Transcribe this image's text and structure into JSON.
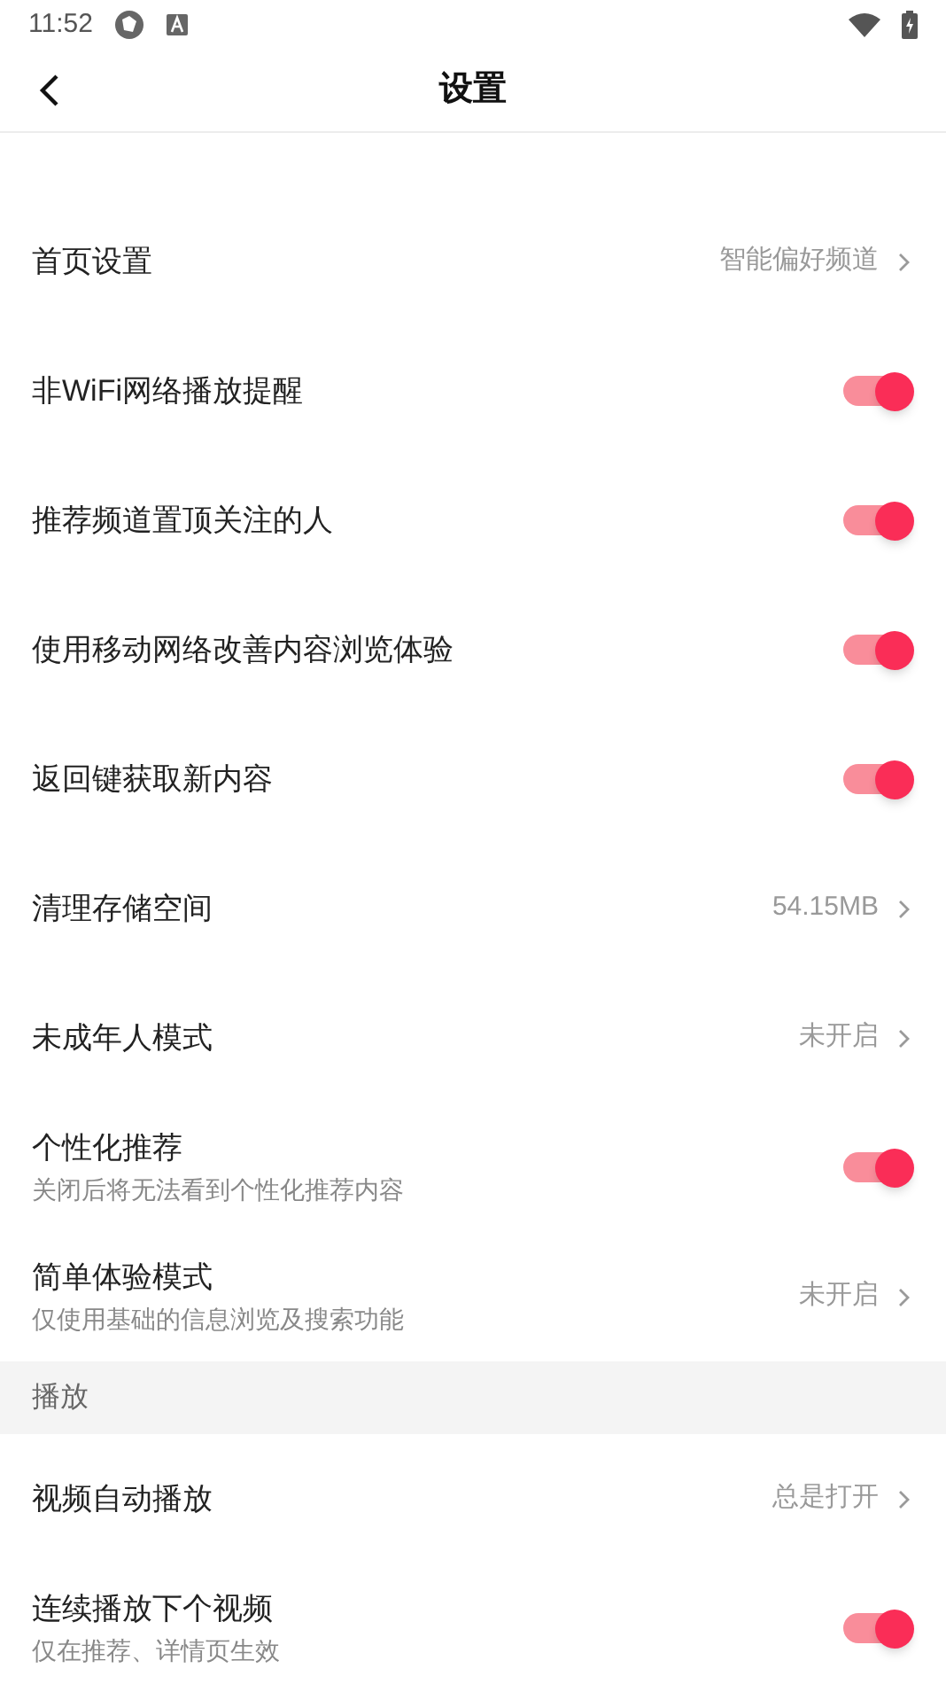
{
  "status_bar": {
    "time": "11:52"
  },
  "header": {
    "title": "设置"
  },
  "items": [
    {
      "kind": "link",
      "label": "首页设置",
      "value": "智能偏好频道"
    },
    {
      "kind": "toggle",
      "label": "非WiFi网络播放提醒",
      "on": true
    },
    {
      "kind": "toggle",
      "label": "推荐频道置顶关注的人",
      "on": true
    },
    {
      "kind": "toggle",
      "label": "使用移动网络改善内容浏览体验",
      "on": true
    },
    {
      "kind": "toggle",
      "label": "返回键获取新内容",
      "on": true
    },
    {
      "kind": "link",
      "label": "清理存储空间",
      "value": "54.15MB"
    },
    {
      "kind": "link",
      "label": "未成年人模式",
      "value": "未开启"
    },
    {
      "kind": "toggle",
      "label": "个性化推荐",
      "subtitle": "关闭后将无法看到个性化推荐内容",
      "on": true
    },
    {
      "kind": "link",
      "label": "简单体验模式",
      "subtitle": "仅使用基础的信息浏览及搜索功能",
      "value": "未开启"
    },
    {
      "kind": "section",
      "label": "播放"
    },
    {
      "kind": "link",
      "label": "视频自动播放",
      "value": "总是打开"
    },
    {
      "kind": "toggle",
      "label": "连续播放下个视频",
      "subtitle": "仅在推荐、详情页生效",
      "on": true
    }
  ]
}
